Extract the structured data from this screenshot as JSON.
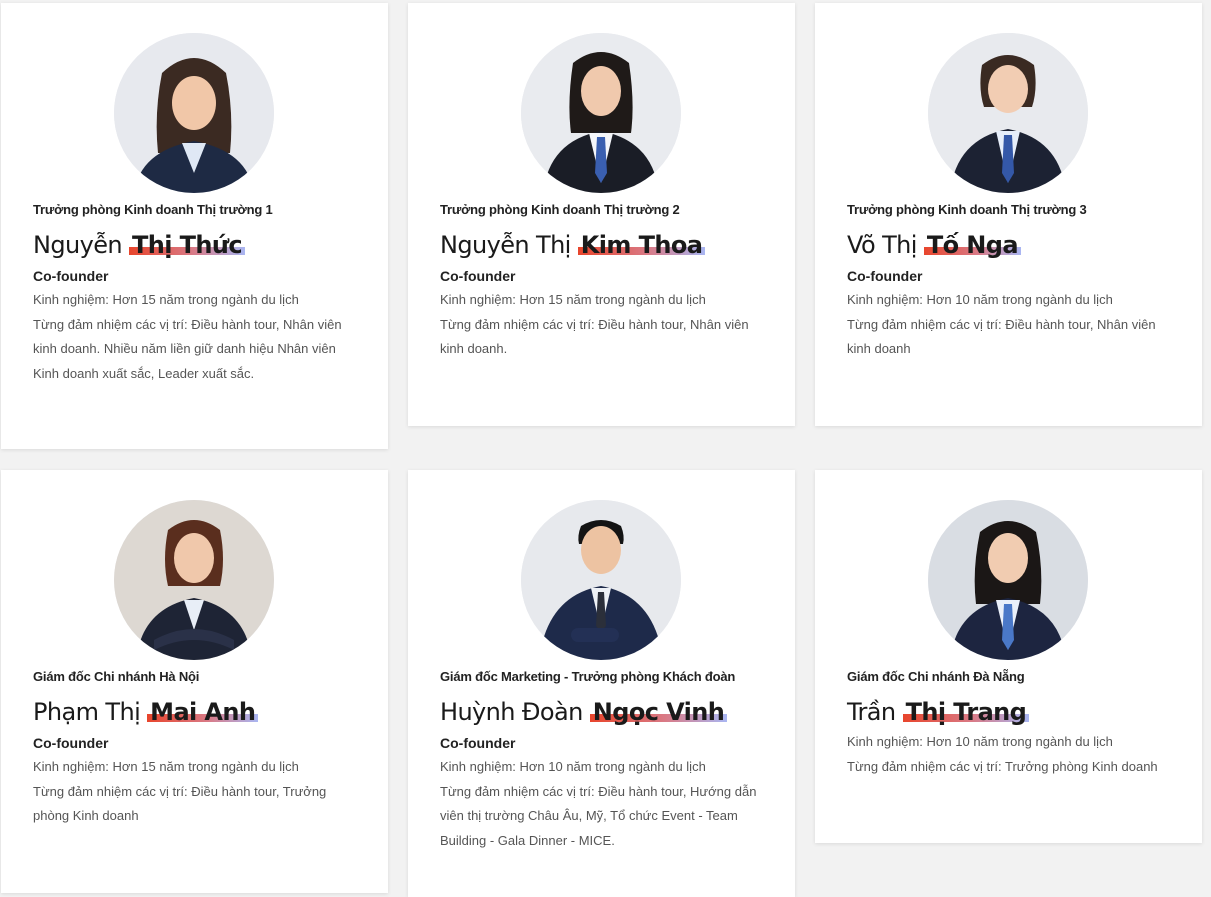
{
  "cards": [
    {
      "role": "Trưởng phòng Kinh doanh Thị trường 1",
      "name_first": "Nguyễn",
      "name_last": "Thị Thức",
      "title": "Co-founder",
      "lines": [
        "Kinh nghiệm: Hơn 15 năm trong ngành du lịch",
        "Từng đảm nhiệm các vị trí: Điều hành tour, Nhân viên kinh doanh. Nhiều năm liền giữ danh hiệu Nhân viên Kinh doanh xuất sắc, Leader xuất sắc."
      ]
    },
    {
      "role": "Trưởng phòng Kinh doanh Thị trường 2",
      "name_first": "Nguyễn Thị",
      "name_last": "Kim Thoa",
      "title": "Co-founder",
      "lines": [
        "Kinh nghiệm: Hơn 15 năm trong ngành du lịch",
        "Từng đảm nhiệm các vị trí: Điều hành tour, Nhân viên kinh doanh."
      ]
    },
    {
      "role": "Trưởng phòng Kinh doanh Thị trường 3",
      "name_first": "Võ Thị",
      "name_last": "Tố Nga",
      "title": "Co-founder",
      "lines": [
        "Kinh nghiệm: Hơn 10 năm trong ngành du lịch",
        "Từng đảm nhiệm các vị trí: Điều hành tour, Nhân viên kinh doanh"
      ]
    },
    {
      "role": "Giám đốc Chi nhánh Hà Nội",
      "name_first": "Phạm Thị",
      "name_last": "Mai Anh",
      "title": "Co-founder",
      "lines": [
        "Kinh nghiệm: Hơn 15 năm trong ngành du lịch",
        "Từng đảm nhiệm các vị trí: Điều hành tour, Trưởng phòng Kinh doanh"
      ]
    },
    {
      "role": "Giám đốc Marketing - Trưởng phòng Khách đoàn",
      "name_first": "Huỳnh Đoàn",
      "name_last": "Ngọc Vinh",
      "title": "Co-founder",
      "lines": [
        "Kinh nghiệm: Hơn 10 năm trong ngành du lịch",
        "Từng đảm nhiệm các vị trí: Điều hành tour, Hướng dẫn viên thị trường Châu Âu, Mỹ, Tổ chức Event - Team Building - Gala Dinner - MICE."
      ]
    },
    {
      "role": "Giám đốc Chi nhánh Đà Nẵng",
      "name_first": "Trần",
      "name_last": "Thị Trang",
      "title": "",
      "lines": [
        "Kinh nghiệm: Hơn 10 năm trong ngành du lịch",
        "Từng đảm nhiệm các vị trí: Trưởng phòng Kinh doanh"
      ]
    }
  ],
  "colors": {
    "highlight_start": "#e8452c",
    "highlight_end": "#a9b6f2",
    "suit": "#1e2a44"
  }
}
